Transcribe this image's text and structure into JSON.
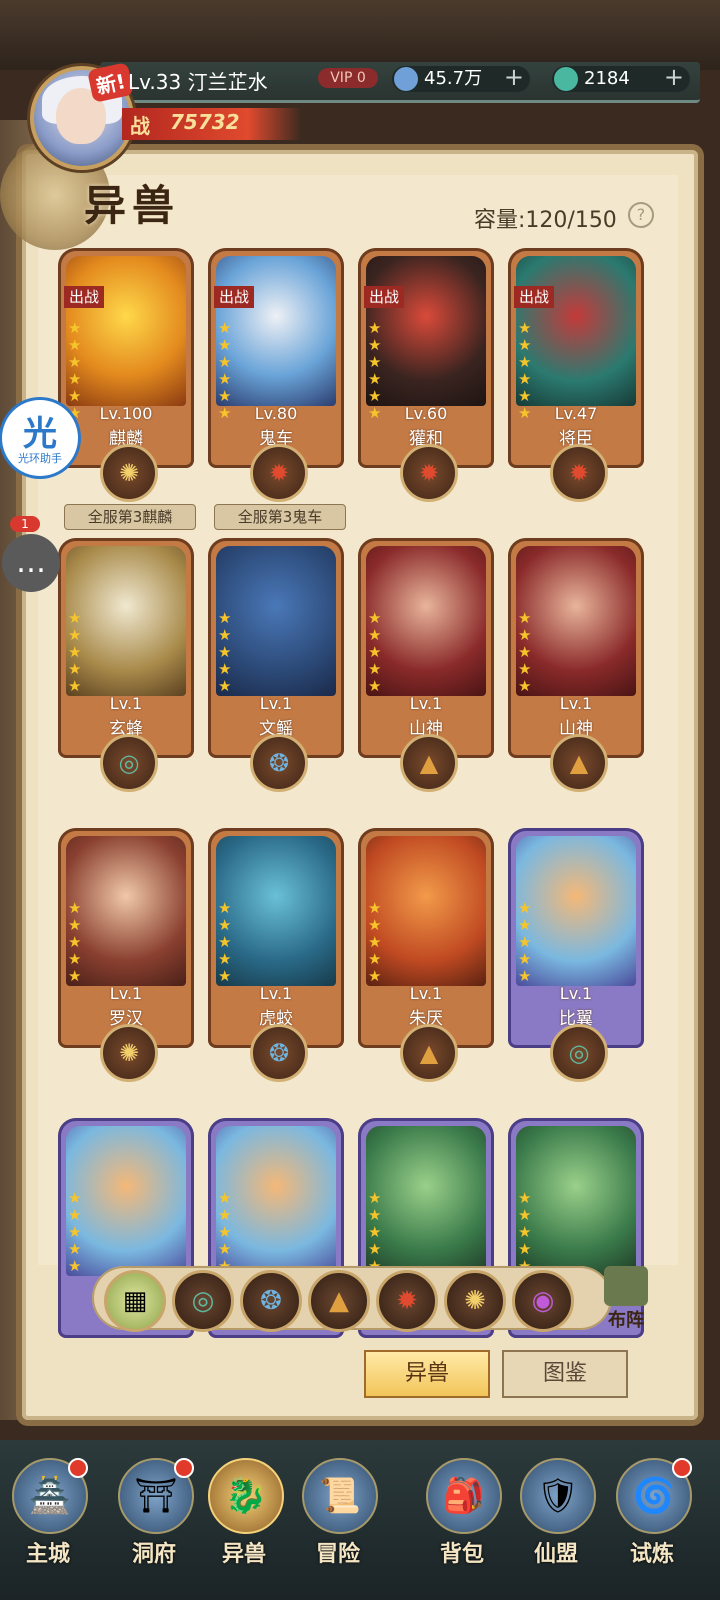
{
  "header": {
    "new_label": "新!",
    "level_name": "Lv.33 汀兰芷水",
    "vip": "VIP 0",
    "currency1": "45.7万",
    "currency2": "2184",
    "power_icon": "战",
    "power": "75732",
    "title": "异兽",
    "capacity": "容量:120/150",
    "help": "?"
  },
  "cards": [
    {
      "badge": "出战",
      "level": "Lv.100",
      "name": "麒麟",
      "element": "sun-icon"
    },
    {
      "badge": "出战",
      "level": "Lv.80",
      "name": "鬼车",
      "element": "flame-icon"
    },
    {
      "badge": "出战",
      "level": "Lv.60",
      "name": "獾和",
      "element": "flame-icon"
    },
    {
      "badge": "出战",
      "level": "Lv.47",
      "name": "将臣",
      "element": "flame-icon"
    },
    {
      "badge": "",
      "level": "Lv.1",
      "name": "玄蜂",
      "element": "dragon-icon"
    },
    {
      "badge": "",
      "level": "Lv.1",
      "name": "文鳐",
      "element": "swirl-icon"
    },
    {
      "badge": "",
      "level": "Lv.1",
      "name": "山神",
      "element": "mountain-icon"
    },
    {
      "badge": "",
      "level": "Lv.1",
      "name": "山神",
      "element": "mountain-icon"
    },
    {
      "badge": "",
      "level": "Lv.1",
      "name": "罗汉",
      "element": "sun-icon"
    },
    {
      "badge": "",
      "level": "Lv.1",
      "name": "虎蛟",
      "element": "swirl-icon"
    },
    {
      "badge": "",
      "level": "Lv.1",
      "name": "朱厌",
      "element": "mountain-icon"
    },
    {
      "badge": "",
      "level": "Lv.1",
      "name": "比翼",
      "element": "dragon-icon"
    },
    {
      "badge": "",
      "level": "",
      "name": "",
      "element": ""
    },
    {
      "badge": "",
      "level": "",
      "name": "",
      "element": ""
    },
    {
      "badge": "",
      "level": "",
      "name": "",
      "element": ""
    },
    {
      "badge": "",
      "level": "",
      "name": "",
      "element": ""
    }
  ],
  "ranks": [
    "全服第3麒麟",
    "全服第3鬼车"
  ],
  "filters": [
    "all-grid-icon",
    "dragon-icon",
    "swirl-icon",
    "mountain-icon",
    "flame-icon",
    "sun-icon",
    "void-icon"
  ],
  "buzhen_label": "布阵",
  "tabs": {
    "beasts": "异兽",
    "atlas": "图鉴"
  },
  "side": {
    "halo_glyph": "光",
    "halo_label": "光环助手",
    "chat_count": "1"
  },
  "nav": [
    {
      "label": "主城",
      "icon": "castle-icon",
      "dot": true
    },
    {
      "label": "洞府",
      "icon": "portal-icon",
      "dot": true
    },
    {
      "label": "异兽",
      "icon": "beast-icon",
      "dot": false,
      "active": true
    },
    {
      "label": "冒险",
      "icon": "scroll-icon",
      "dot": false
    },
    {
      "label": "背包",
      "icon": "bag-icon",
      "dot": false
    },
    {
      "label": "仙盟",
      "icon": "guild-icon",
      "dot": false
    },
    {
      "label": "试炼",
      "icon": "trial-icon",
      "dot": true
    }
  ],
  "colors": {
    "panel": "#efe2c2",
    "card_bronze": "#c47a45",
    "card_purple": "#8a79c4",
    "badge_red": "#9c2a23",
    "accent_gold": "#f6c42b"
  }
}
